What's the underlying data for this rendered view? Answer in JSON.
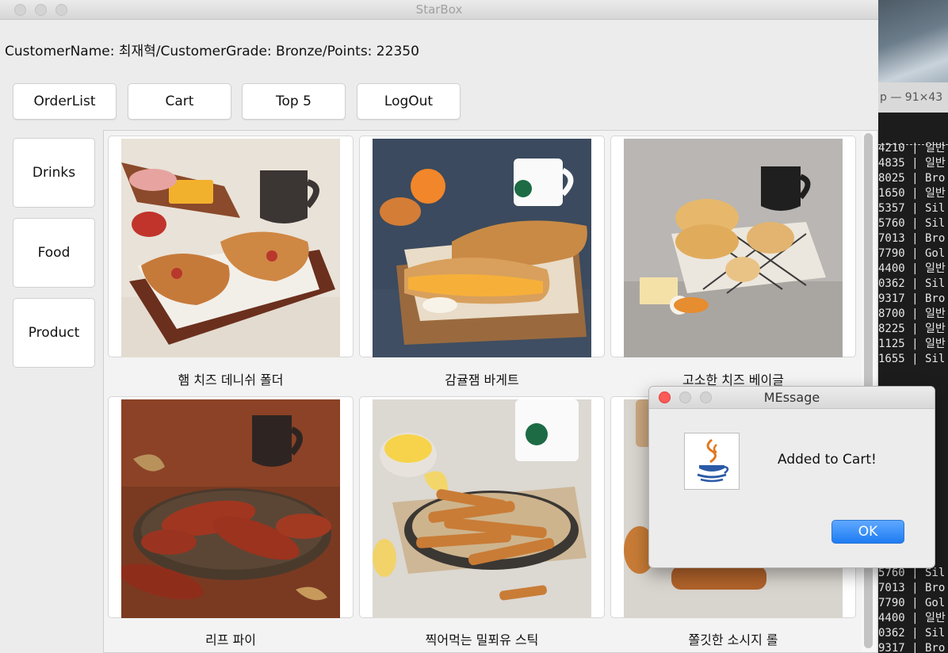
{
  "window": {
    "title": "StarBox"
  },
  "customer_info": "CustomerName: 최재혁/CustomerGrade: Bronze/Points: 22350",
  "top_buttons": [
    "OrderList",
    "Cart",
    "Top 5",
    "LogOut"
  ],
  "side_buttons": [
    "Drinks",
    "Food",
    "Product"
  ],
  "products": [
    {
      "name": "햄 치즈 데니쉬 폴더"
    },
    {
      "name": "감귤잼 바게트"
    },
    {
      "name": "고소한 치즈 베이글"
    },
    {
      "name": "리프 파이"
    },
    {
      "name": "찍어먹는 밀푀유 스틱"
    },
    {
      "name": "쫄깃한 소시지 롤"
    }
  ],
  "dialog": {
    "title": "MEssage",
    "message": "Added to Cart!",
    "ok_label": "OK"
  },
  "terminal": {
    "title": "p — 91×43",
    "rows_top": [
      "4210 | 일반",
      "4835 | 일반",
      "8025 | Bro",
      "1650 | 일반",
      "5357 | Sil",
      "5760 | Sil",
      "7013 | Bro",
      "7790 | Gol",
      "4400 | 일반",
      "0362 | Sil",
      "9317 | Bro",
      "8700 | 일반",
      "8225 | 일반",
      "1125 | 일반",
      "1655 | Sil"
    ],
    "rows_bottom": [
      "5760 | Sil",
      "7013 | Bro",
      "7790 | Gol",
      "4400 | 일반",
      "0362 | Sil",
      "9317 | Bro"
    ]
  }
}
